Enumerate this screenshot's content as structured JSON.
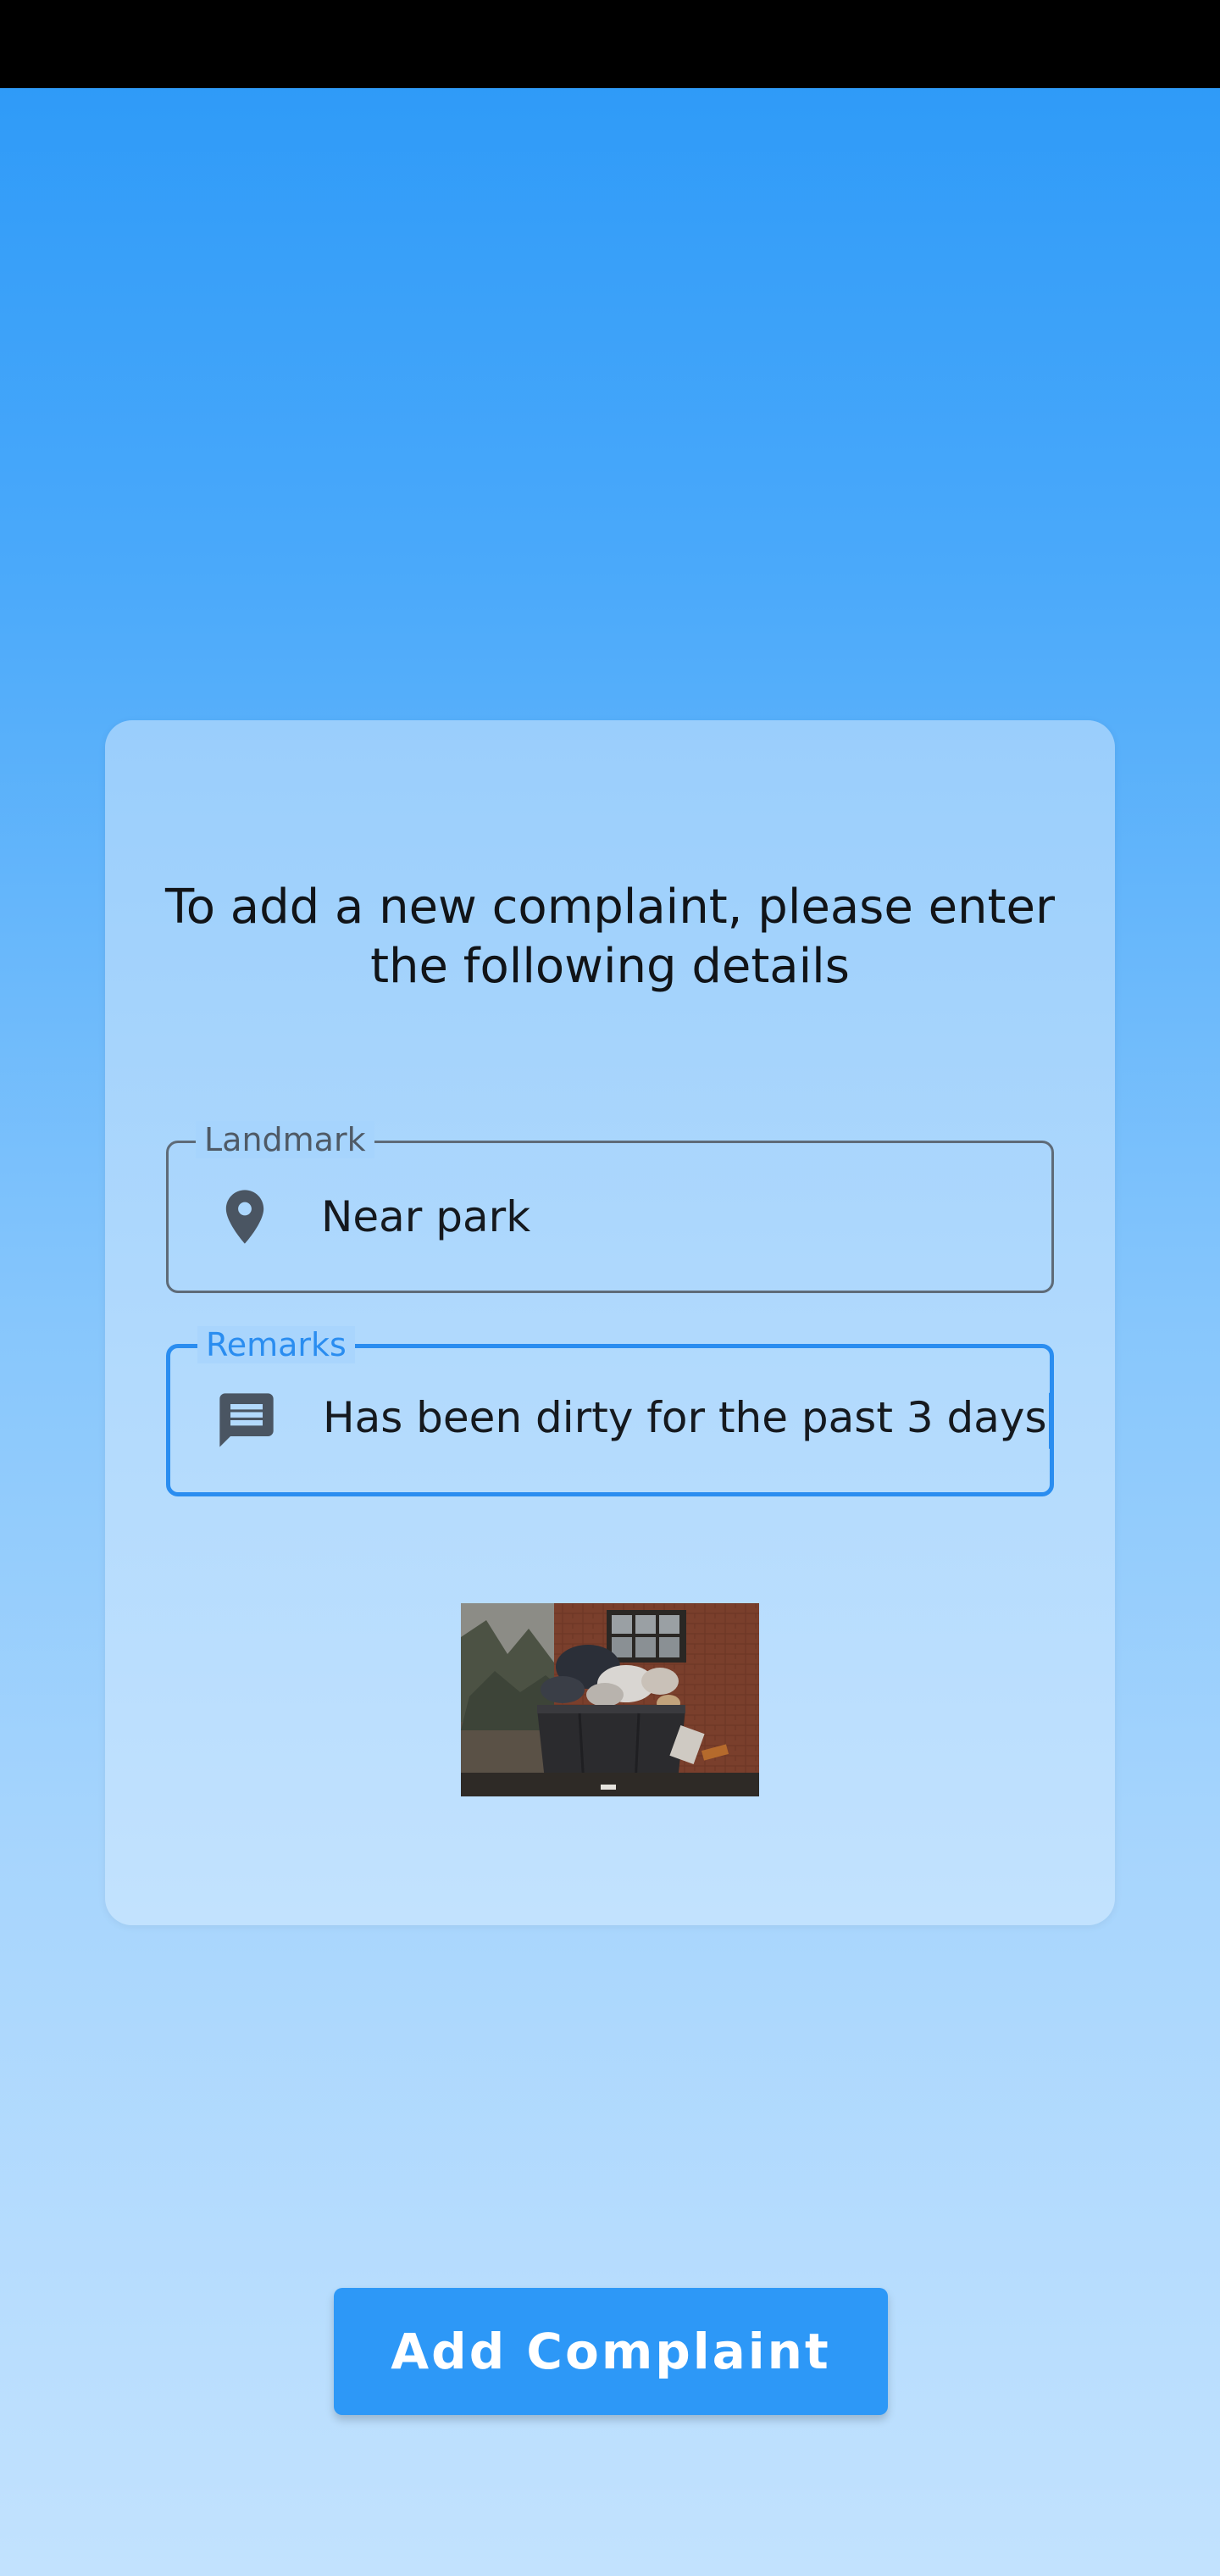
{
  "instructions": "To add a new complaint, please enter\nthe following details",
  "landmark": {
    "label": "Landmark",
    "value": "Near park",
    "icon": "location-pin-icon"
  },
  "remarks": {
    "label": "Remarks",
    "value": "Has been dirty for the past 3 days",
    "icon": "message-icon"
  },
  "attached_photo": {
    "icon": "garbage-photo"
  },
  "add_button": {
    "label": "Add Complaint"
  },
  "colors": {
    "accent": "#2a8df0",
    "button": "#2d98f7",
    "status_bar": "#000000"
  }
}
